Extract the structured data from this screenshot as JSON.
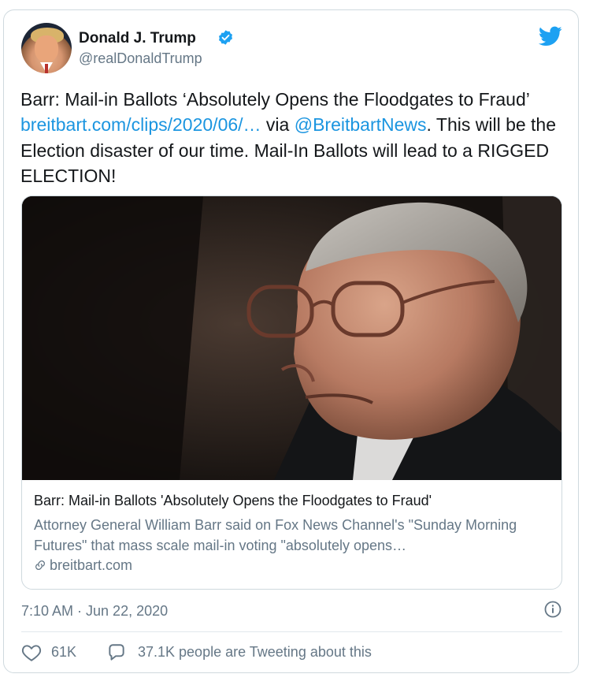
{
  "author": {
    "display_name": "Donald J. Trump",
    "handle": "@realDonaldTrump",
    "verified": true
  },
  "tweet": {
    "text_intro": "Barr: Mail-in Ballots ‘Absolutely Opens the Floodgates to Fraud’ ",
    "link_text": "breitbart.com/clips/2020/06/…",
    "text_via": " via ",
    "mention": "@BreitbartNews",
    "text_rest": ". This will be the Election disaster of our time. Mail-In Ballots will lead to a RIGGED ELECTION!"
  },
  "embed": {
    "title": "Barr: Mail-in Ballots 'Absolutely Opens the Floodgates to Fraud'",
    "description": "Attorney General William Barr said on Fox News Channel's \"Sunday Morning Futures\" that mass scale mail-in voting \"absolutely opens…",
    "domain": "breitbart.com"
  },
  "meta": {
    "timestamp": "7:10 AM · Jun 22, 2020"
  },
  "actions": {
    "likes": "61K",
    "replies_text": "37.1K people are Tweeting about this"
  },
  "colors": {
    "accent": "#1b95e0",
    "secondary_text": "#657786",
    "border": "#cfd9de",
    "verified": "#1da1f2"
  },
  "icons": {
    "verified": "verified-badge-icon",
    "brand": "twitter-bird-icon",
    "info": "info-icon",
    "like": "heart-icon",
    "reply": "speech-bubble-icon",
    "link": "link-icon"
  }
}
